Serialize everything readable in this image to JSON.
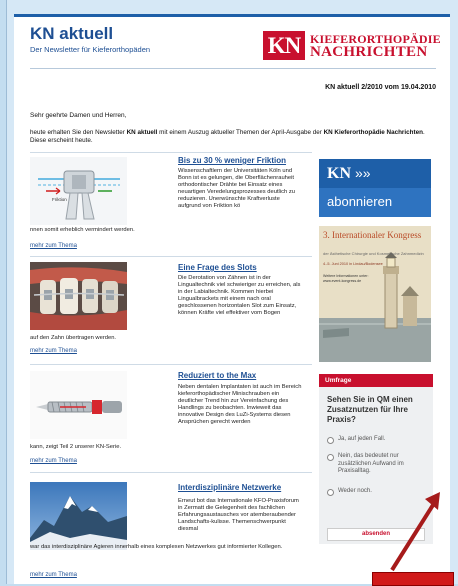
{
  "header": {
    "title": "KN aktuell",
    "subtitle": "Der Newsletter für Kieferorthopäden",
    "logo_mark": "KN",
    "logo_line1": "KIEFERORTHOPÄDIE",
    "logo_line2": "NACHRICHTEN"
  },
  "issue": "KN aktuell 2/2010 vom 19.04.2010",
  "greeting": "Sehr geehrte Damen und Herren,",
  "intro": {
    "part1": "heute erhalten Sie den Newsletter ",
    "bold1": "KN aktuell",
    "part2": " mit einem Auszug aktueller Themen der April-Ausgabe der ",
    "bold2": "KN Kieferorthopädie Nachrichten",
    "part3": ". Diese erscheint heute."
  },
  "articles": [
    {
      "title": "Bis zu 30 % weniger Friktion",
      "body": "Wissenschaftlern der Universitäten Köln und Bonn ist es gelungen, die Oberflächenrauheit orthodontischer Drähte bei Einsatz eines neuartigen Veredelungsprozesses deutlich zu reduzieren. Unerwünschte Kraftverluste aufgrund von Friktion kö",
      "tail": "nnen somit erheblich vermindert werden.",
      "more": "mehr zum Thema",
      "image_label": "Friktion"
    },
    {
      "title": "Eine Frage des Slots",
      "body": "Die Derotation von Zähnen ist in der Lingualtechnik viel schwieriger zu erreichen, als in der Labialtechnik. Kommen hierbei Lingualbrackets mit einem nach oral geschlossenen horizontalen Slot zum Einsatz, können Kräfte viel effektiver vom Bogen",
      "tail": "auf den Zahn übertragen werden.",
      "more": "mehr zum Thema"
    },
    {
      "title": "Reduziert to the Max",
      "body": "Neben dentalen Implantaten ist auch im Bereich kieferorthopädischer Minischrauben ein deutlicher Trend hin zur Vereinfachung des Handlings zu beobachten. Inwieweit das innovative Design des LuZi-Systems diesen Ansprüchen gerecht werden",
      "tail": "kann, zeigt Teil 2 unserer KN-Serie.",
      "more": "mehr zum Thema"
    },
    {
      "title": "Interdisziplinäre Netzwerke",
      "body": "Erneut bot das Internationale KFO-Praxisforum in Zermatt die Gelegenheit des fachlichen Erfahrungsaustausches vor atemberaubender Landschafts-kulisse. Themenschwerpunkt diesmal",
      "tail": "war das interdisziplinäre Agieren innerhalb eines komplexen Netzwerkes gut informierter Kollegen.",
      "more": "mehr zum Thema"
    }
  ],
  "sidebar": {
    "banner_kn": "KN",
    "banner_arrows": "»»",
    "banner_sub": "abonnieren",
    "congress_title": "3. Internationaler Kongress",
    "congress_sub": "der Ästhetische Chirurgie und Kosmetische Zahnmedizin",
    "congress_date": "4.-5. Juni 2010 in Lindau/Bodensee",
    "congress_info": "Weitere Informationen unter: www.event-kongress.de"
  },
  "survey": {
    "header": "Umfrage",
    "question": "Sehen Sie in QM einen Zusatznutzen für Ihre Praxis?",
    "options": [
      "Ja, auf jeden Fall.",
      "Nein, das bedeutet nur zusätzlichen Aufwand im Praxisalltag.",
      "Weder noch."
    ],
    "submit": "absenden"
  },
  "colors": {
    "brand_blue": "#1e4f93",
    "brand_red": "#c8102e",
    "arrow_red": "#a61b1b"
  }
}
